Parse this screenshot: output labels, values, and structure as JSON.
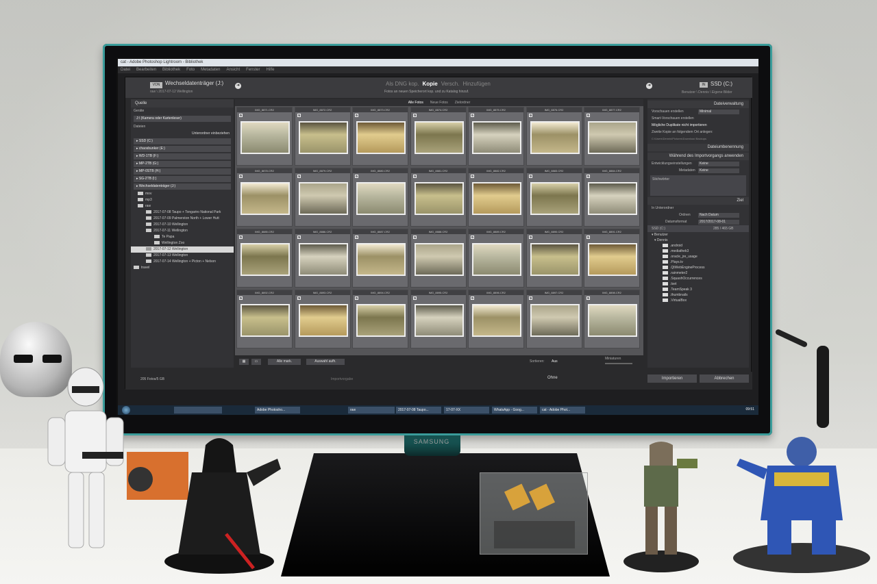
{
  "window": {
    "title": "cat - Adobe Photoshop Lightroom - Bibliothek"
  },
  "menu": [
    "Datei",
    "Bearbeiten",
    "Bibliothek",
    "Foto",
    "Metadaten",
    "Ansicht",
    "Fenster",
    "Hilfe"
  ],
  "source": {
    "chip": "VON",
    "name": "Wechseldatenträger (J:)",
    "path": "raw \\ 2017-07-12 Wellington"
  },
  "modes": {
    "items": [
      "Als DNG kop.",
      "Kopie",
      "Versch.",
      "Hinzufügen"
    ],
    "active": "Kopie",
    "description": "Fotos an neuen Speicherort kop. und zu Katalog hinzuf."
  },
  "destination": {
    "chip": "IN",
    "name": "SSD (C:)",
    "path": "Benutzer \\ Dennis \\ Eigene Bilder"
  },
  "left_panel": {
    "header": "Quelle",
    "devices_label": "Geräte",
    "device": "J:\\ (Kamera oder Kartenleser)",
    "files_label": "Dateien",
    "subfolders": "Unterordner einbeziehen",
    "volumes": [
      "SSD (C:)",
      "chaosbunker (E:)",
      "WD-1TB (F:)",
      "MP-2TB (G:)",
      "MP-0STB (H:)",
      "SG-2TB (I:)",
      "Wechseldatenträger (J:)"
    ],
    "folders": [
      "mov",
      "mp3",
      "raw",
      "2017-07-08 Taupo + Tongariro National Park",
      "2017-07-09 Palmerston North + Lower Hutt",
      "2017-07-10 Wellington",
      "2017-07-11 Wellington",
      "Te Papa",
      "Wellington Zoo",
      "2017-07-12 Wellington",
      "2017-07-13 Wellington",
      "2017-07-14 Wellington + Picton + Nelson",
      "travel"
    ],
    "selected_folder": "2017-07-12 Wellington"
  },
  "grid": {
    "tabs": [
      "Alle Fotos",
      "Neue Fotos",
      "Zielordner"
    ],
    "active_tab": "Alle Fotos",
    "files": [
      "IMG_8871.CR2",
      "IMG_8872.CR2",
      "IMG_8873.CR2",
      "IMG_8874.CR2",
      "IMG_8875.CR2",
      "IMG_8876.CR2",
      "IMG_8877.CR2",
      "IMG_8878.CR2",
      "IMG_8879.CR2",
      "IMG_8880.CR2",
      "IMG_8881.CR2",
      "IMG_8882.CR2",
      "IMG_8883.CR2",
      "IMG_8884.CR2",
      "IMG_8885.CR2",
      "IMG_8886.CR2",
      "IMG_8887.CR2",
      "IMG_8888.CR2",
      "IMG_8889.CR2",
      "IMG_8890.CR2",
      "IMG_8891.CR2",
      "IMG_8892.CR2",
      "IMG_8893.CR2",
      "IMG_8894.CR2",
      "IMG_8895.CR2",
      "IMG_8896.CR2",
      "IMG_8897.CR2",
      "IMG_8898.CR2"
    ],
    "select_all": "Alle mark.",
    "deselect": "Auswahl aufh.",
    "sort_label": "Sortieren:",
    "sort_value": "Aus",
    "thumbs_label": "Miniaturen"
  },
  "right_panel": {
    "file_handling": "Dateiverwaltung",
    "previews_label": "Vorschauen erstellen",
    "previews_value": "Minimal",
    "smart_previews": "Smart-Vorschauen erstellen",
    "no_duplicates": "Mögliche Duplikate nicht importieren",
    "second_copy": "Zweite Kopie an folgendem Ort anlegen:",
    "second_copy_path": "C:\\Users\\Dennis\\Pictures\\Download Backups",
    "rename": "Dateiumbenennung",
    "apply": "Während des Importvorgangs anwenden",
    "dev_label": "Entwicklungseinstellungen",
    "dev_value": "Keine",
    "meta_label": "Metadaten",
    "meta_value": "Keine",
    "keywords": "Stichwörter",
    "dest_header": "Ziel",
    "into_subfolder": "In Unterordner",
    "organize_label": "Ordnen",
    "organize_value": "Nach Datum",
    "date_label": "Datumsformat",
    "date_value": "2017/2017-08-01",
    "volume": "SSD (C:)",
    "volume_space": "285 / 465 GB",
    "tree": [
      "Benutzer",
      "Dennis",
      ".android",
      ".mediathek3",
      ".oracle_jre_usage",
      ".Plays.tv",
      ".QtWebEngineProcess",
      ".rainmeter2",
      ".SquashOccurrences",
      ".tset",
      ".TeamSpeak 3",
      ".thumbnails",
      ".VirtualBox"
    ]
  },
  "bottom": {
    "count": "205 Fotos/5 GB",
    "preset_label": "Importvorgabe",
    "preset_value": "Ohne",
    "import": "Importieren",
    "cancel": "Abbrechen"
  },
  "taskbar": {
    "items": [
      "",
      "Adobe Photosho...",
      "raw",
      "2017-07-08 Taupo...",
      "17-07-XX",
      "WhatsApp - Goog...",
      "cat - Adobe Phot..."
    ],
    "time": "09:51"
  },
  "monitor": {
    "brand": "SAMSUNG"
  }
}
